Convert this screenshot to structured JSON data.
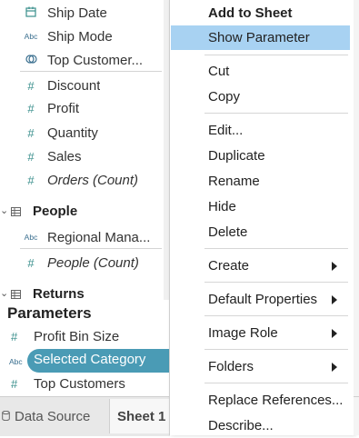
{
  "data_pane": {
    "fields": [
      {
        "icon": "calendar-icon",
        "glyph": "🗓",
        "label": "Ship Date",
        "italic": false
      },
      {
        "icon": "abc-string-icon",
        "glyph": "Abc",
        "label": "Ship Mode",
        "italic": false
      },
      {
        "icon": "linked-set-icon",
        "glyph": "⊘",
        "label": "Top Customer...",
        "italic": false
      },
      {
        "icon": "number-measure-icon",
        "glyph": "#",
        "label": "Discount",
        "italic": false
      },
      {
        "icon": "number-measure-icon",
        "glyph": "#",
        "label": "Profit",
        "italic": false
      },
      {
        "icon": "number-measure-icon",
        "glyph": "#",
        "label": "Quantity",
        "italic": false
      },
      {
        "icon": "number-measure-icon",
        "glyph": "#",
        "label": "Sales",
        "italic": false
      },
      {
        "icon": "number-measure-icon",
        "glyph": "#",
        "label": "Orders (Count)",
        "italic": true
      }
    ],
    "people_folder": {
      "label": "People"
    },
    "people_fields": [
      {
        "icon": "abc-string-icon",
        "glyph": "Abc",
        "label": "Regional Mana...",
        "italic": false
      },
      {
        "icon": "number-measure-icon",
        "glyph": "#",
        "label": "People (Count)",
        "italic": true
      }
    ],
    "returns_folder": {
      "label": "Returns"
    }
  },
  "parameters": {
    "heading": "Parameters",
    "items": [
      {
        "icon": "number-measure-icon",
        "glyph": "#",
        "label": "Profit Bin Size",
        "selected": false
      },
      {
        "icon": "abc-string-icon",
        "glyph": "Abc",
        "label": "Selected Category",
        "selected": true
      },
      {
        "icon": "number-measure-icon",
        "glyph": "#",
        "label": "Top Customers",
        "selected": false
      }
    ]
  },
  "tabs": {
    "data_source": "Data Source",
    "sheet": "Sheet 1"
  },
  "context_menu": {
    "items": [
      {
        "label": "Add to Sheet",
        "bold": true,
        "highlighted": false,
        "submenu": false
      },
      {
        "label": "Show Parameter",
        "bold": false,
        "highlighted": true,
        "submenu": false
      },
      {
        "label": "Cut",
        "bold": false,
        "highlighted": false,
        "submenu": false
      },
      {
        "label": "Copy",
        "bold": false,
        "highlighted": false,
        "submenu": false
      },
      {
        "label": "Edit...",
        "bold": false,
        "highlighted": false,
        "submenu": false
      },
      {
        "label": "Duplicate",
        "bold": false,
        "highlighted": false,
        "submenu": false
      },
      {
        "label": "Rename",
        "bold": false,
        "highlighted": false,
        "submenu": false
      },
      {
        "label": "Hide",
        "bold": false,
        "highlighted": false,
        "submenu": false
      },
      {
        "label": "Delete",
        "bold": false,
        "highlighted": false,
        "submenu": false
      },
      {
        "label": "Create",
        "bold": false,
        "highlighted": false,
        "submenu": true
      },
      {
        "label": "Default Properties",
        "bold": false,
        "highlighted": false,
        "submenu": true
      },
      {
        "label": "Image Role",
        "bold": false,
        "highlighted": false,
        "submenu": true
      },
      {
        "label": "Folders",
        "bold": false,
        "highlighted": false,
        "submenu": true
      },
      {
        "label": "Replace References...",
        "bold": false,
        "highlighted": false,
        "submenu": false
      },
      {
        "label": "Describe...",
        "bold": false,
        "highlighted": false,
        "submenu": false
      }
    ]
  },
  "colors": {
    "highlight": "#a8d2f2",
    "selected_pill": "#4a9bb5",
    "measure_icon": "#3a8f8c"
  }
}
